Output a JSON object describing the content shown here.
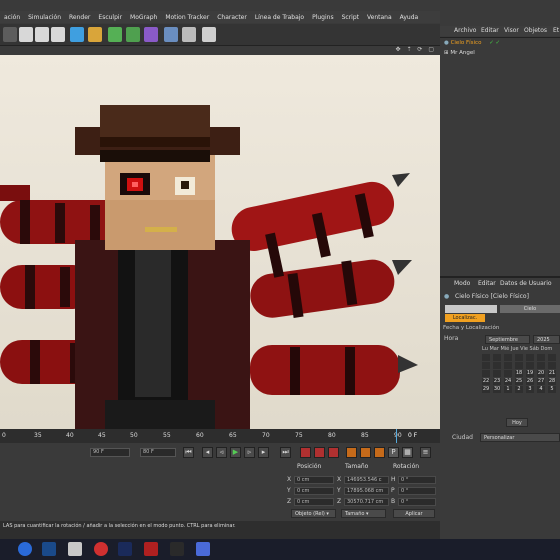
{
  "menubar": {
    "items": [
      "ación",
      "Simulación",
      "Render",
      "Esculpir",
      "MoGraph",
      "Motion Tracker",
      "Character",
      "Línea de Trabajo",
      "Plugins",
      "Script",
      "Ventana",
      "Ayuda"
    ]
  },
  "colors": {
    "accent": "#5aa0d8",
    "viewport_bg": "#e9e3d6",
    "panel_bg": "#3a3a3a",
    "selection": "#f0a020"
  },
  "timeline": {
    "ticks": [
      "0",
      "35",
      "40",
      "45",
      "50",
      "55",
      "60",
      "65",
      "70",
      "75",
      "80",
      "85",
      "90"
    ],
    "frame_field": "90 F",
    "end_field": "80 F",
    "current_label": "0 F"
  },
  "coords": {
    "headers": {
      "position": "Posición",
      "size": "Tamaño",
      "rotation": "Rotación"
    },
    "rows": [
      {
        "axis": "X",
        "pos": "0 cm",
        "size_axis": "X",
        "size": "146953.546 c",
        "rot_axis": "H",
        "rot": "0 °"
      },
      {
        "axis": "Y",
        "pos": "0 cm",
        "size_axis": "Y",
        "size": "17895.068 cm",
        "rot_axis": "P",
        "rot": "0 °"
      },
      {
        "axis": "Z",
        "pos": "0 cm",
        "size_axis": "Z",
        "size": "30570.717 cm",
        "rot_axis": "B",
        "rot": "0 °"
      }
    ],
    "mode_dropdown": "Objeto (Rel) ▾",
    "size_dropdown": "Tamaño ▾",
    "apply_button": "Aplicar"
  },
  "status": {
    "text": "LAS para cuantificar la rotación / añadir a la selección en el modo punto. CTRL para eliminar."
  },
  "object_manager": {
    "menu": [
      "Archivo",
      "Editar",
      "Visor",
      "Objetos",
      "Et"
    ],
    "objects": [
      "Cielo Físico",
      "Mr Angel"
    ]
  },
  "attribute_manager": {
    "menu": [
      "Modo",
      "Editar",
      "Datos de Usuario"
    ],
    "title": "Cielo Físico [Cielo Físico]",
    "tabs": [
      "",
      "Cielo"
    ],
    "subtab": "Localizac.",
    "section": "Fecha y Localización",
    "hora_label": "Hora",
    "month": "Septiembre",
    "year": "2025",
    "weekday_headers": "Lu Mar Mié Jue Vie Sáb Dom",
    "days": [
      "",
      "",
      "",
      "",
      "",
      "",
      "",
      "",
      "",
      "",
      "",
      "",
      "",
      "",
      "",
      "",
      "",
      "18",
      "19",
      "20",
      "21",
      "22",
      "23",
      "24",
      "25",
      "26",
      "27",
      "28",
      "29",
      "30",
      "1",
      "2",
      "3",
      "4",
      "5"
    ],
    "today_button": "Hoy",
    "ciudad_label": "Ciudad",
    "ciudad_value": "Personalizar"
  }
}
